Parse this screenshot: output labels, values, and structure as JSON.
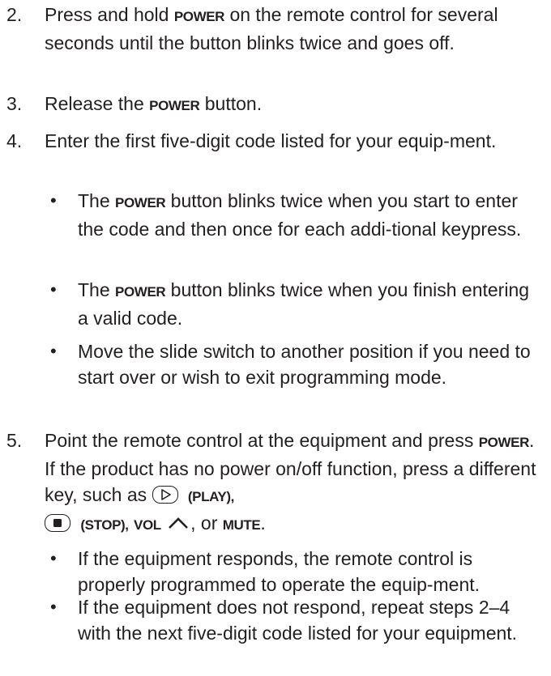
{
  "steps": [
    {
      "number": "2.",
      "text_a": "Press and hold ",
      "key_a": "POWER",
      "text_b": " on the remote control for several seconds until the button blinks twice and goes off."
    },
    {
      "number": "3.",
      "text_a": "Release the ",
      "key_a": "POWER",
      "text_b": " button."
    },
    {
      "number": "4.",
      "text_a": "Enter the first five-digit code listed for your equip-ment.",
      "bullets": [
        {
          "text_a": "The ",
          "key_a": "POWER",
          "text_b": " button blinks twice when you start to enter the code and then once for each addi-tional keypress."
        },
        {
          "text_a": "The ",
          "key_a": "POWER",
          "text_b": " button blinks twice when you finish entering a valid code."
        },
        {
          "text_a": "Move the slide switch to another position if you need to start over or wish to exit programming mode."
        }
      ]
    },
    {
      "number": "5.",
      "text_a": "Point the remote control at the equipment and press ",
      "key_a": "POWER",
      "text_b": ".  If the product has no power on/off function, press a different key, such as ",
      "key_play": "(PLAY),",
      "key_stop": "(STOP),",
      "key_vol": "VOL",
      "text_c": ", or ",
      "key_mute": "MUTE",
      "text_d": ".",
      "bullets": [
        {
          "text_a": "If the equipment responds, the remote control is properly programmed to operate the equip-ment."
        },
        {
          "text_a": "If the equipment does not respond, repeat steps 2–4 with the next five-digit code listed for your equipment."
        }
      ]
    }
  ],
  "icons": {
    "play": "play-button-icon",
    "stop": "stop-button-icon",
    "volume_up": "caret-up-icon"
  }
}
